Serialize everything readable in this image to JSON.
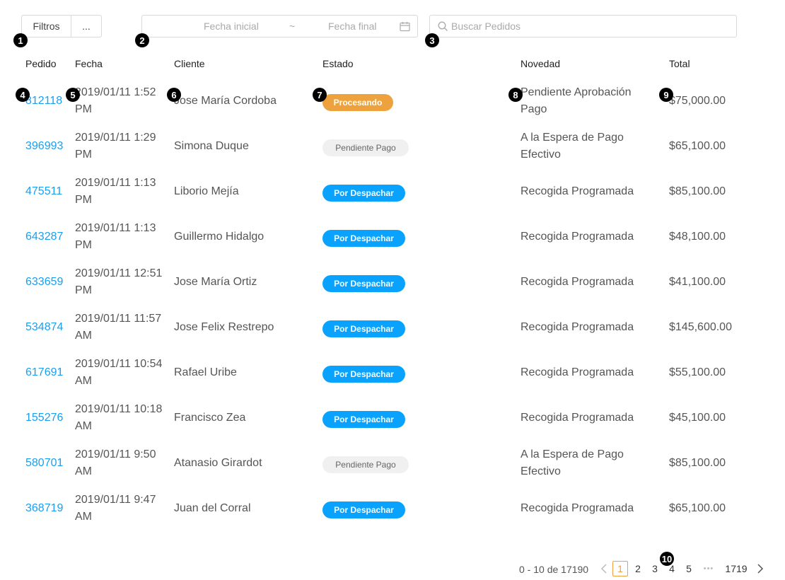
{
  "toolbar": {
    "filters_label": "Filtros",
    "more_label": "...",
    "date_start_placeholder": "Fecha inicial",
    "date_separator": "~",
    "date_end_placeholder": "Fecha final",
    "search_placeholder": "Buscar Pedidos"
  },
  "markers": [
    "1",
    "2",
    "3",
    "4",
    "5",
    "6",
    "7",
    "8",
    "9",
    "10"
  ],
  "table": {
    "headers": {
      "pedido": "Pedido",
      "fecha": "Fecha",
      "cliente": "Cliente",
      "estado": "Estado",
      "novedad": "Novedad",
      "total": "Total"
    },
    "rows": [
      {
        "id": "812118",
        "date": "2019/01/11 1:52 PM",
        "client": "Jose María Cordoba",
        "status": "Procesando",
        "status_color": "orange",
        "novedad": "Pendiente Aprobación Pago",
        "total": "$75,000.00"
      },
      {
        "id": "396993",
        "date": "2019/01/11 1:29 PM",
        "client": "Simona Duque",
        "status": "Pendiente Pago",
        "status_color": "gray",
        "novedad": "A la Espera de Pago Efectivo",
        "total": "$65,100.00"
      },
      {
        "id": "475511",
        "date": "2019/01/11 1:13 PM",
        "client": "Liborio Mejía",
        "status": "Por Despachar",
        "status_color": "blue",
        "novedad": "Recogida Programada",
        "total": "$85,100.00"
      },
      {
        "id": "643287",
        "date": "2019/01/11 1:13 PM",
        "client": "Guillermo Hidalgo",
        "status": "Por Despachar",
        "status_color": "blue",
        "novedad": "Recogida Programada",
        "total": "$48,100.00"
      },
      {
        "id": "633659",
        "date": "2019/01/11 12:51 PM",
        "client": "Jose María Ortiz",
        "status": "Por Despachar",
        "status_color": "blue",
        "novedad": "Recogida Programada",
        "total": "$41,100.00"
      },
      {
        "id": "534874",
        "date": "2019/01/11 11:57 AM",
        "client": "Jose Felix Restrepo",
        "status": "Por Despachar",
        "status_color": "blue",
        "novedad": "Recogida Programada",
        "total": "$145,600.00"
      },
      {
        "id": "617691",
        "date": "2019/01/11 10:54 AM",
        "client": "Rafael Uribe",
        "status": "Por Despachar",
        "status_color": "blue",
        "novedad": "Recogida Programada",
        "total": "$55,100.00"
      },
      {
        "id": "155276",
        "date": "2019/01/11 10:18 AM",
        "client": "Francisco Zea",
        "status": "Por Despachar",
        "status_color": "blue",
        "novedad": "Recogida Programada",
        "total": "$45,100.00"
      },
      {
        "id": "580701",
        "date": "2019/01/11 9:50 AM",
        "client": "Atanasio Girardot",
        "status": "Pendiente Pago",
        "status_color": "gray",
        "novedad": "A la Espera de Pago Efectivo",
        "total": "$85,100.00"
      },
      {
        "id": "368719",
        "date": "2019/01/11 9:47 AM",
        "client": "Juan del Corral",
        "status": "Por Despachar",
        "status_color": "blue",
        "novedad": "Recogida Programada",
        "total": "$65,100.00"
      }
    ]
  },
  "pagination": {
    "range_text": "0 - 10 de 17190",
    "pages": [
      "1",
      "2",
      "3",
      "4",
      "5"
    ],
    "current": "1",
    "ellipsis": "•••",
    "last_page": "1719"
  },
  "colors": {
    "link": "#1a9ff0",
    "orange": "#eea23d",
    "blue": "#0aa2ff",
    "gray": "#f0f0f0"
  }
}
